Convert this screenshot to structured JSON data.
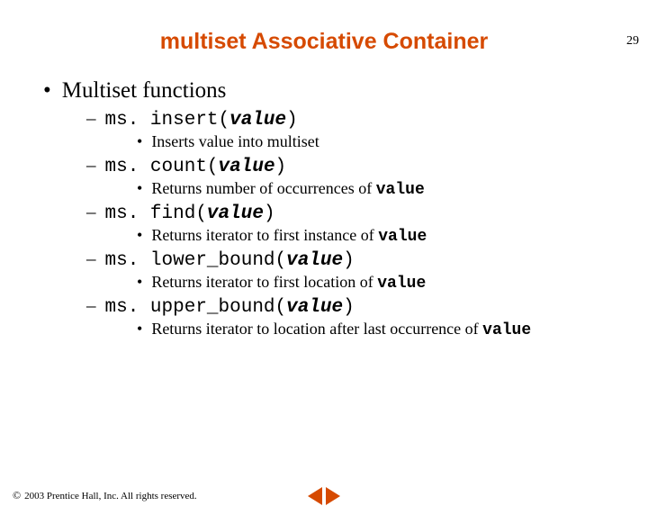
{
  "page_number": "29",
  "title": "multiset Associative Container",
  "heading": "Multiset functions",
  "items": [
    {
      "code_prefix": "ms. insert(",
      "code_param": "value",
      "code_suffix": ")",
      "desc_prefix": "Inserts value into multiset",
      "desc_mono": ""
    },
    {
      "code_prefix": "ms. count(",
      "code_param": "value",
      "code_suffix": ")",
      "desc_prefix": "Returns number of occurrences of ",
      "desc_mono": "value"
    },
    {
      "code_prefix": "ms. find(",
      "code_param": "value",
      "code_suffix": ")",
      "desc_prefix": "Returns iterator to first instance of ",
      "desc_mono": "value"
    },
    {
      "code_prefix": "ms. lower_bound(",
      "code_param": "value",
      "code_suffix": ")",
      "desc_prefix": "Returns iterator to first location of  ",
      "desc_mono": "value"
    },
    {
      "code_prefix": "ms. upper_bound(",
      "code_param": "value",
      "code_suffix": ")",
      "desc_prefix": "Returns iterator to location after last occurrence of ",
      "desc_mono": "value"
    }
  ],
  "copyright": "2003 Prentice Hall, Inc. All rights reserved."
}
